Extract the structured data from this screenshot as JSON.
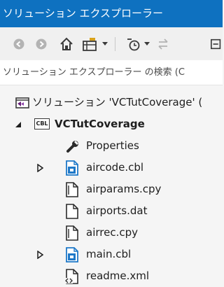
{
  "window": {
    "title": "ソリューション エクスプローラー"
  },
  "toolbar": {
    "back_icon": "back-arrow-icon",
    "forward_icon": "forward-arrow-icon",
    "home_icon": "home-icon",
    "switch_views_icon": "switch-views-icon",
    "pending_changes_icon": "history-clock-icon",
    "sync_icon": "sync-icon",
    "collapse_icon": "collapse-all-icon"
  },
  "search": {
    "placeholder": "ソリューション エクスプローラー の検索 (C"
  },
  "tree": {
    "solution_label": "ソリューション 'VCTutCoverage' (",
    "project": {
      "label": "VCTutCoverage",
      "badge": "CBL"
    },
    "items": [
      {
        "label": "Properties",
        "icon": "wrench-icon"
      },
      {
        "label": "aircode.cbl",
        "icon": "cobol-source-icon"
      },
      {
        "label": "airparams.cpy",
        "icon": "copybook-icon"
      },
      {
        "label": "airports.dat",
        "icon": "file-icon"
      },
      {
        "label": "airrec.cpy",
        "icon": "copybook-icon"
      },
      {
        "label": "main.cbl",
        "icon": "cobol-source-icon"
      },
      {
        "label": "readme.xml",
        "icon": "xml-file-icon"
      }
    ]
  },
  "colors": {
    "title_bg": "#0e71c0",
    "toolbar_bg": "#f0f0f0",
    "tree_bg": "#f5f5f5",
    "accent_blue": "#1e78c8"
  }
}
